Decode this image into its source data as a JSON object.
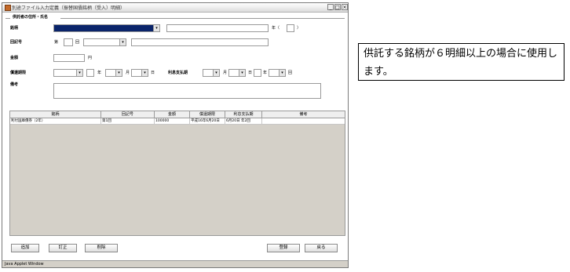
{
  "window": {
    "title": "別途ファイル入力定義（振替国債銘柄（受入）明細）",
    "controls": {
      "minimize": "_",
      "maximize": "□",
      "close": "×"
    }
  },
  "form": {
    "group_title": "供託者の住所・氏名",
    "meigara": {
      "label": "銘柄",
      "paren_open": "年（",
      "paren_close": "）"
    },
    "kaigou": {
      "label": "回記号",
      "dai": "第",
      "kai": "回"
    },
    "kingaku": {
      "label": "金額",
      "unit": "円"
    },
    "shokan": {
      "label": "償還期限",
      "nen": "年",
      "tsuki": "月",
      "hi": "日"
    },
    "rishi": {
      "label": "利息支払期",
      "tsuki": "月",
      "hi": "日",
      "nen": "年",
      "kai": "回"
    },
    "bikou": {
      "label": "備考"
    }
  },
  "table": {
    "columns": [
      "銘柄",
      "回記号",
      "金額",
      "償還期限",
      "利息支払期",
      "備考"
    ],
    "rows": [
      [
        "利付国庫債券（2年）",
        "第1回",
        "100000",
        "平成16年6月20日",
        "6月20日 年2回",
        ""
      ]
    ]
  },
  "buttons": {
    "add": "追加",
    "edit": "訂正",
    "delete": "削除",
    "register": "登録",
    "back": "戻る"
  },
  "status_bar": "Java Applet Window",
  "note": "供託する銘柄が６明細以上の場合に使用します。"
}
